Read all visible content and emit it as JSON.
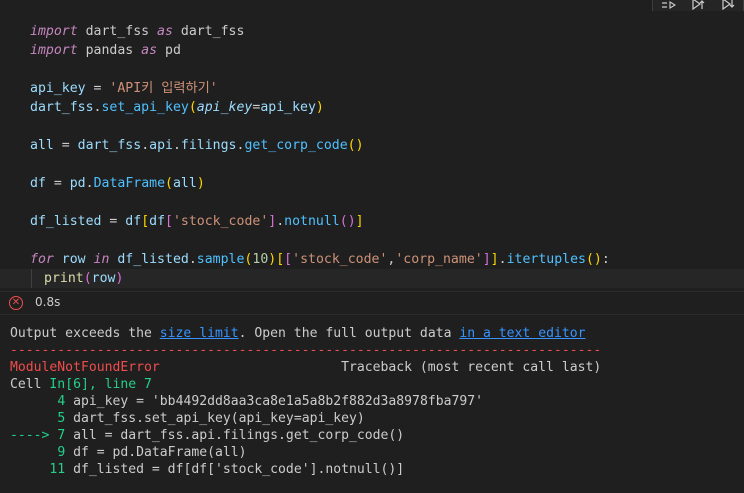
{
  "toolbar": {
    "buttons": [
      "run-by-line-icon",
      "execute-above-icon",
      "execute-below-icon"
    ]
  },
  "code": {
    "l1": {
      "kw1": "import",
      "mod": " dart_fss ",
      "kw2": "as",
      "alias": " dart_fss"
    },
    "l2": {
      "kw1": "import",
      "mod": " pandas ",
      "kw2": "as",
      "alias": " pd"
    },
    "l4": {
      "var": "api_key",
      "eq": " = ",
      "str": "'API키 입력하기'"
    },
    "l5": {
      "obj": "dart_fss",
      "dot": ".",
      "fn": "set_api_key",
      "open": "(",
      "param": "api_key",
      "eq": "=",
      "arg": "api_key",
      "close": ")"
    },
    "l7": {
      "var": "all",
      "eq": " = ",
      "obj": "dart_fss",
      "d1": ".",
      "m1": "api",
      "d2": ".",
      "m2": "filings",
      "d3": ".",
      "fn": "get_corp_code",
      "parens": "()"
    },
    "l9": {
      "var": "df",
      "eq": " = ",
      "obj": "pd",
      "dot": ".",
      "fn": "DataFrame",
      "open": "(",
      "arg": "all",
      "close": ")"
    },
    "l11": {
      "var": "df_listed",
      "eq": " = ",
      "obj1": "df",
      "b1": "[",
      "obj2": "df",
      "b2": "[",
      "str": "'stock_code'",
      "b3": "]",
      "dot": ".",
      "fn": "notnull",
      "parens": "()",
      "b4": "]"
    },
    "l13": {
      "kw1": "for",
      "var": " row ",
      "kw2": "in",
      "obj": " df_listed",
      "dot": ".",
      "fn": "sample",
      "p1": "(",
      "num": "10",
      "p2": ")",
      "b1": "[",
      "b2": "[",
      "s1": "'stock_code'",
      "comma": ",",
      "s2": "'corp_name'",
      "b3": "]",
      "b4": "]",
      "dot2": ".",
      "fn2": "itertuples",
      "p3": "()",
      "colon": ":"
    },
    "l14": {
      "fn": "print",
      "open": "(",
      "arg": "row",
      "close": ")"
    }
  },
  "status": {
    "icon": "error-circle-icon",
    "duration": "0.8s"
  },
  "output": {
    "exceeds_pre": "Output exceeds the ",
    "size_limit": "size limit",
    "exceeds_mid": ". Open the full output data ",
    "text_editor": "in a text editor",
    "dashes": "---------------------------------------------------------------------------",
    "error_name": "ModuleNotFoundError",
    "traceback": "                       Traceback (most recent call last)",
    "cell_pre": "Cell ",
    "cell_in": "In[6], line 7",
    "tb": [
      {
        "arrow": "      ",
        "num": "4",
        "code": " api_key = 'bb4492dd8aa3ca8e1a5a8b2f882d3a8978fba797'"
      },
      {
        "arrow": "      ",
        "num": "5",
        "code": " dart_fss.set_api_key(api_key=api_key)"
      },
      {
        "arrow": "----> ",
        "num": "7",
        "code": " all = dart_fss.api.filings.get_corp_code()"
      },
      {
        "arrow": "      ",
        "num": "9",
        "code": " df = pd.DataFrame(all)"
      },
      {
        "arrow": "     ",
        "num": "11",
        "code": " df_listed = df[df['stock_code'].notnull()]"
      }
    ]
  }
}
